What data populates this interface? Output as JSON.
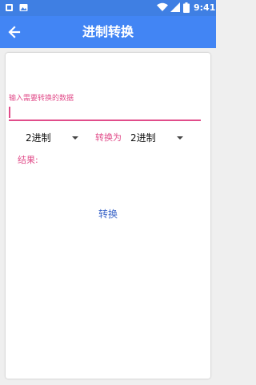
{
  "status_bar": {
    "time": "9:41",
    "icons": [
      "notification-icon",
      "image-icon",
      "wifi-icon",
      "signal-icon",
      "battery-icon"
    ]
  },
  "app_bar": {
    "title": "进制转换",
    "back_icon": "arrow-left-icon"
  },
  "form": {
    "input_label": "输入需要转换的数据",
    "input_value": "",
    "from_base": "2进制",
    "to_label": "转换为",
    "to_base": "2进制",
    "result_label": "结果:",
    "convert_button": "转换"
  },
  "colors": {
    "primary": "#4285f4",
    "status": "#3f7fe3",
    "accent": "#e14d8a",
    "button_text": "#3a64c8"
  }
}
